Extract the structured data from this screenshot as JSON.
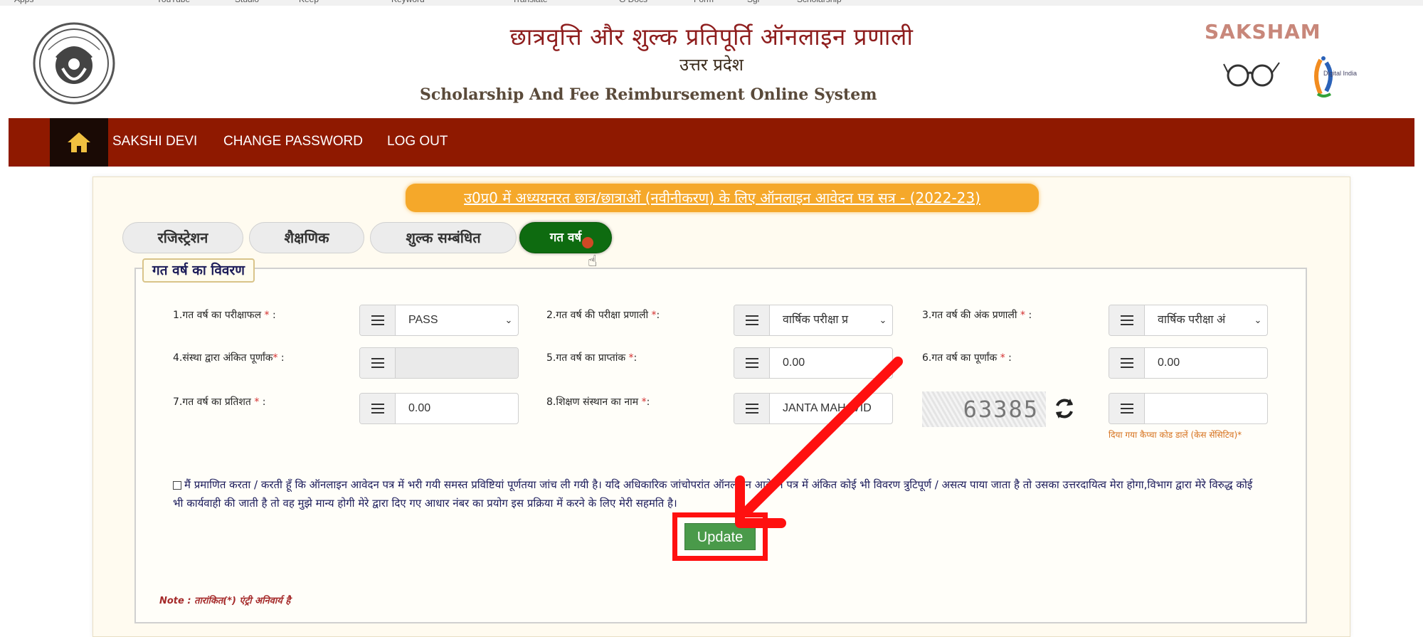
{
  "bookmarks": [
    "Apps",
    "YouTube",
    "Studio",
    "Keep",
    "Keyword",
    "Translate",
    "G Docs",
    "Form",
    "Sgi",
    "Scholarship"
  ],
  "header": {
    "title_hi": "छात्रवृत्ति और शुल्क प्रतिपूर्ति ऑनलाइन प्रणाली",
    "subtitle_hi": "उत्तर प्रदेश",
    "title_en": "Scholarship And Fee Reimbursement Online System",
    "brand": "SAKSHAM",
    "digital_india": "Digital India"
  },
  "nav": {
    "user_name": "SAKSHI DEVI",
    "change_password": "CHANGE PASSWORD",
    "logout": "LOG OUT"
  },
  "banner": "उ0प्र0 में अध्ययनरत छात्र/छात्राओं (नवीनीकरण) के लिए ऑनलाइन आवेदन पत्र सत्र - (2022-23)",
  "tabs": [
    {
      "label": "रजिस्ट्रेशन",
      "active": false
    },
    {
      "label": "शैक्षणिक",
      "active": false
    },
    {
      "label": "शुल्क सम्बंधित",
      "active": false
    },
    {
      "label": "गत वर्ष",
      "active": true
    }
  ],
  "section_title": "गत वर्ष का विवरण",
  "fields": [
    {
      "label": "1.गत वर्ष का परीक्षाफल",
      "value": "PASS",
      "type": "select"
    },
    {
      "label": "2.गत वर्ष की परीक्षा प्रणाली",
      "value": "वार्षिक परीक्षा प्र",
      "type": "select"
    },
    {
      "label": "3.गत वर्ष की अंक प्रणाली",
      "value": "वार्षिक परीक्षा अं",
      "type": "select"
    },
    {
      "label": "4.संस्था द्वारा अंकित पूर्णांक",
      "value": "",
      "type": "input-disabled"
    },
    {
      "label": "5.गत वर्ष का प्राप्तांक",
      "value": "0.00",
      "type": "input"
    },
    {
      "label": "6.गत वर्ष का पूर्णांक",
      "value": "0.00",
      "type": "input"
    },
    {
      "label": "7.गत वर्ष का प्रतिशत",
      "value": "0.00",
      "type": "input"
    },
    {
      "label": "8.शिक्षण संस्थान का नाम",
      "value": "JANTA MAHAVID",
      "type": "input"
    }
  ],
  "required_mark": "*",
  "captcha": {
    "code": "63385",
    "input_value": "",
    "hint": "दिया गया कैप्चा कोड डालें (केस सेंसिटिव)*"
  },
  "declaration": "मैं प्रमाणित करता / करती हूँ कि ऑनलाइन आवेदन पत्र में भरी गयी समस्त प्रविष्टियां पूर्णतया जांच ली गयी है। यदि अधिकारिक जांचोपरांत ऑनलाइन आवेदन पत्र में अंकित कोई भी विवरण त्रुटिपूर्ण / असत्य पाया जाता है तो उसका उत्तरदायित्व मेरा होगा,विभाग द्वारा मेरे विरुद्ध कोई भी कार्यवाही की जाती है तो वह मुझे मान्य होगी मेरे द्वारा दिए गए आधार नंबर का प्रयोग इस प्रक्रिया में करने के लिए मेरी सहमति है।",
  "update_label": "Update",
  "note": "Note : तारांकित(*) एंट्री अनिवार्य है",
  "colors": {
    "navbar": "#8f1900",
    "banner": "#f5a82a",
    "active_tab": "#0e6b10",
    "update_button": "#4a9a4a",
    "annotation": "#ff1010"
  }
}
